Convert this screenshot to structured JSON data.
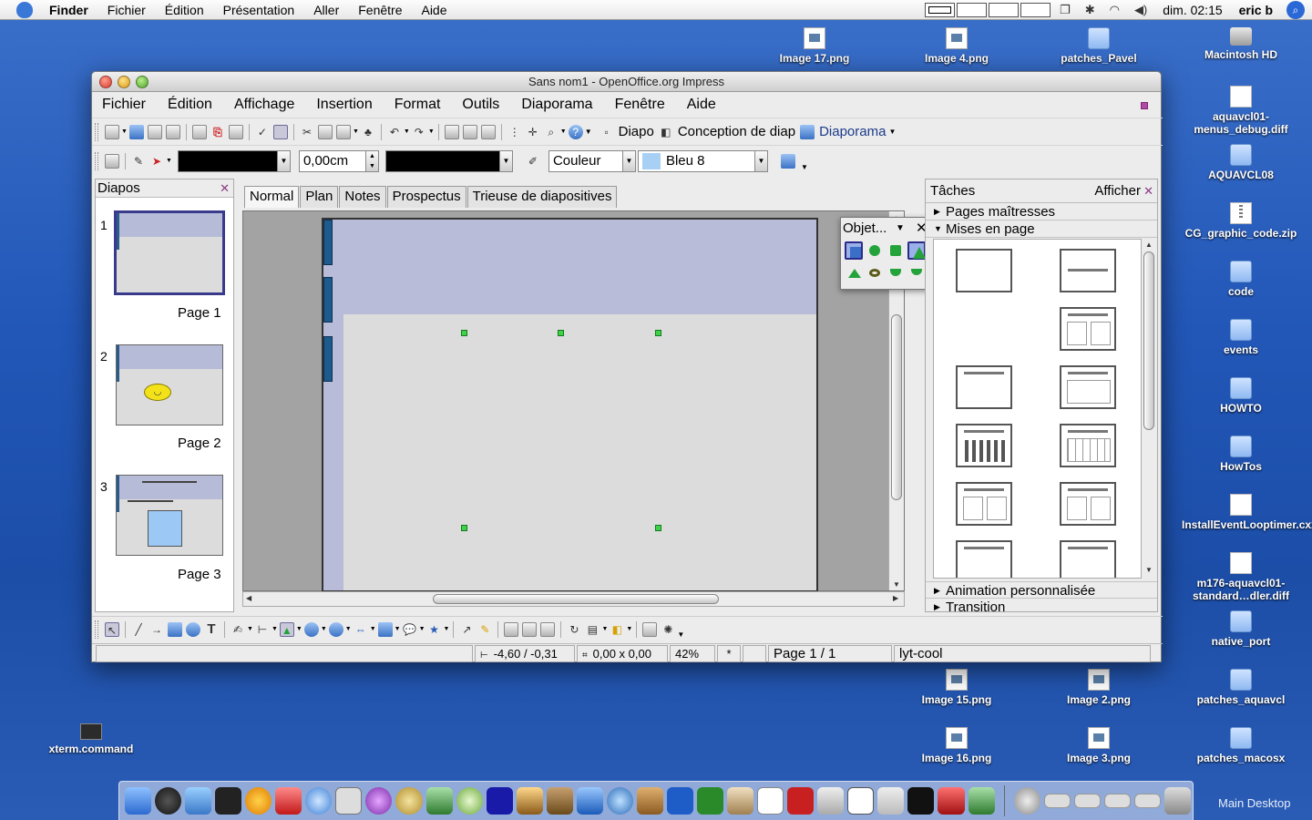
{
  "menubar": {
    "app": "Finder",
    "items": [
      "Fichier",
      "Édition",
      "Présentation",
      "Aller",
      "Fenêtre",
      "Aide"
    ],
    "clock": "dim. 02:15",
    "user": "eric b"
  },
  "desktop": {
    "icons": [
      {
        "label": "Image 17.png",
        "type": "png"
      },
      {
        "label": "Image 4.png",
        "type": "png"
      },
      {
        "label": "patches_Pavel",
        "type": "folder"
      },
      {
        "label": "Macintosh HD",
        "type": "hd"
      },
      {
        "label": "aquavcl01-menus_debug.diff",
        "type": "doc"
      },
      {
        "label": "AQUAVCL08",
        "type": "folder"
      },
      {
        "label": "CG_graphic_code.zip",
        "type": "zip"
      },
      {
        "label": "code",
        "type": "folder"
      },
      {
        "label": "events",
        "type": "folder"
      },
      {
        "label": "HOWTO",
        "type": "folder"
      },
      {
        "label": "HowTos",
        "type": "folder"
      },
      {
        "label": "InstallEventLooptimer.cxx",
        "type": "doc"
      },
      {
        "label": "m176-aquavcl01-standard…dler.diff",
        "type": "doc"
      },
      {
        "label": "native_port",
        "type": "folder"
      },
      {
        "label": "patches_aquavcl",
        "type": "folder"
      },
      {
        "label": "patches_macosx",
        "type": "folder"
      },
      {
        "label": "Image 15.png",
        "type": "png"
      },
      {
        "label": "Image 2.png",
        "type": "png"
      },
      {
        "label": "Image 16.png",
        "type": "png"
      },
      {
        "label": "Image 3.png",
        "type": "png"
      },
      {
        "label": "xterm.command",
        "type": "term"
      }
    ]
  },
  "window": {
    "title": "Sans nom1 - OpenOffice.org Impress",
    "menu": [
      "Fichier",
      "Édition",
      "Affichage",
      "Insertion",
      "Format",
      "Outils",
      "Diaporama",
      "Fenêtre",
      "Aide"
    ],
    "toolbar1": {
      "diapo_label": "Diapo",
      "conception_label": "Conception de diap",
      "diaporama_label": "Diaporama"
    },
    "toolbar2": {
      "line_width": "0,00cm",
      "area_style": "Couleur",
      "area_color": "Bleu 8"
    },
    "slides_pane": {
      "title": "Diapos",
      "slides": [
        {
          "num": "1",
          "label": "Page 1"
        },
        {
          "num": "2",
          "label": "Page 2"
        },
        {
          "num": "3",
          "label": "Page 3"
        }
      ]
    },
    "view_tabs": [
      "Normal",
      "Plan",
      "Notes",
      "Prospectus",
      "Trieuse de diapositives"
    ],
    "objects_palette": {
      "title": "Objet..."
    },
    "tasks_pane": {
      "title": "Tâches",
      "view_menu": "Afficher",
      "sections": {
        "master": "Pages maîtresses",
        "layouts": "Mises en page",
        "animation": "Animation personnalisée",
        "transition": "Transition"
      }
    },
    "statusbar": {
      "position": "-4,60 / -0,31",
      "size": "0,00 x 0,00",
      "zoom": "42%",
      "modified": "*",
      "page": "Page 1 / 1",
      "layout_name": "lyt-cool"
    }
  },
  "dock": {
    "label": "Main Desktop"
  },
  "colors": {
    "desktop": "#2257b8",
    "slide_band": "#b8bcd8",
    "handle": "#3fd14a"
  }
}
